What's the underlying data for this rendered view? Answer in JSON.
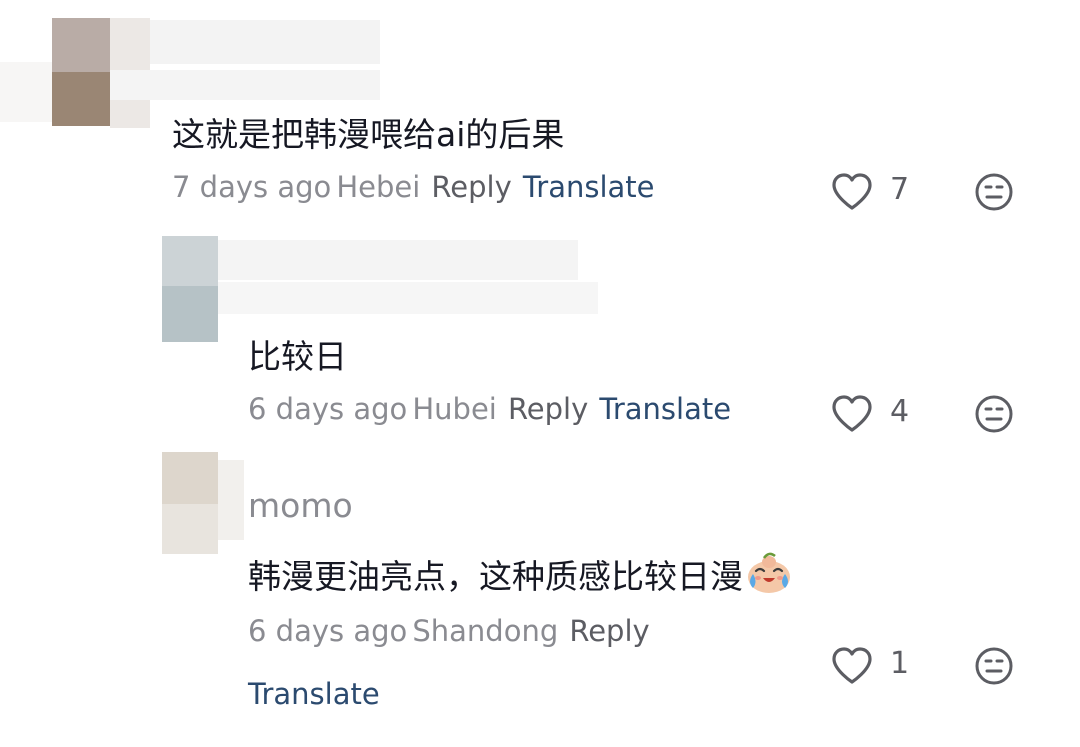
{
  "comments": [
    {
      "text": "这就是把韩漫喂给ai的后果",
      "time": "7 days ago",
      "location": "Hebei",
      "reply_label": "Reply",
      "translate_label": "Translate",
      "likes": "7",
      "like_icon": "heart-icon",
      "react_icon": "emoji-face-icon"
    },
    {
      "text": "比较日",
      "time": "6 days ago",
      "location": "Hubei",
      "reply_label": "Reply",
      "translate_label": "Translate",
      "likes": "4",
      "like_icon": "heart-icon",
      "react_icon": "emoji-face-icon"
    },
    {
      "username": "momo",
      "text": "韩漫更油亮点，这种质感比较日漫",
      "emoji": "crying-face-emoji",
      "time": "6 days ago",
      "location": "Shandong",
      "reply_label": "Reply",
      "translate_label": "Translate",
      "likes": "1",
      "like_icon": "heart-icon",
      "react_icon": "emoji-face-icon"
    }
  ],
  "colors": {
    "text": "#161823",
    "meta": "#8a8b91",
    "translate": "#2b4a6f"
  }
}
